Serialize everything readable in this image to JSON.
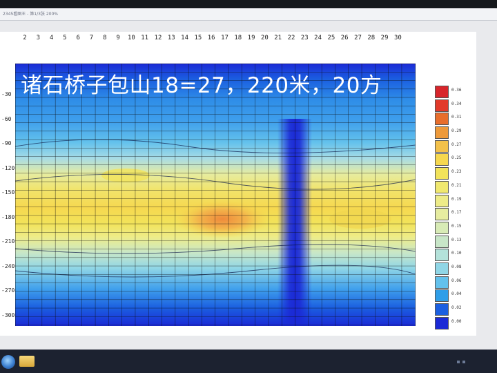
{
  "window": {
    "title": "2345看图王 - 第1/3张 200%"
  },
  "overlay": {
    "text": "诸石桥子包山18=27，220米，20方"
  },
  "plot": {
    "x_ticks": [
      "2",
      "3",
      "4",
      "5",
      "6",
      "7",
      "8",
      "9",
      "10",
      "11",
      "12",
      "13",
      "14",
      "15",
      "16",
      "17",
      "18",
      "19",
      "20",
      "21",
      "22",
      "23",
      "24",
      "25",
      "26",
      "27",
      "28",
      "29",
      "30"
    ],
    "y_ticks": [
      "-30",
      "-60",
      "-90",
      "-120",
      "-150",
      "-180",
      "-210",
      "-240",
      "-270",
      "-300"
    ]
  },
  "legend": {
    "items": [
      {
        "label": "0.36",
        "color": "#d8252b"
      },
      {
        "label": "0.34",
        "color": "#e23a2a"
      },
      {
        "label": "0.31",
        "color": "#e86e2c"
      },
      {
        "label": "0.29",
        "color": "#ee9a3a"
      },
      {
        "label": "0.27",
        "color": "#f3c14b"
      },
      {
        "label": "0.25",
        "color": "#f6d84f"
      },
      {
        "label": "0.23",
        "color": "#f2e35a"
      },
      {
        "label": "0.21",
        "color": "#f0e86f"
      },
      {
        "label": "0.19",
        "color": "#eeec88"
      },
      {
        "label": "0.17",
        "color": "#e6eca0"
      },
      {
        "label": "0.15",
        "color": "#d8ebb6"
      },
      {
        "label": "0.13",
        "color": "#c8e6c8"
      },
      {
        "label": "0.10",
        "color": "#b4e2da"
      },
      {
        "label": "0.08",
        "color": "#90d6e6"
      },
      {
        "label": "0.06",
        "color": "#63c1ec"
      },
      {
        "label": "0.04",
        "color": "#2f9ee8"
      },
      {
        "label": "0.02",
        "color": "#1b5fe0"
      },
      {
        "label": "0.00",
        "color": "#1b2ad6"
      }
    ]
  },
  "taskbar": {
    "start_icon": "windows-start-icon",
    "folder_icon": "folder-icon"
  }
}
